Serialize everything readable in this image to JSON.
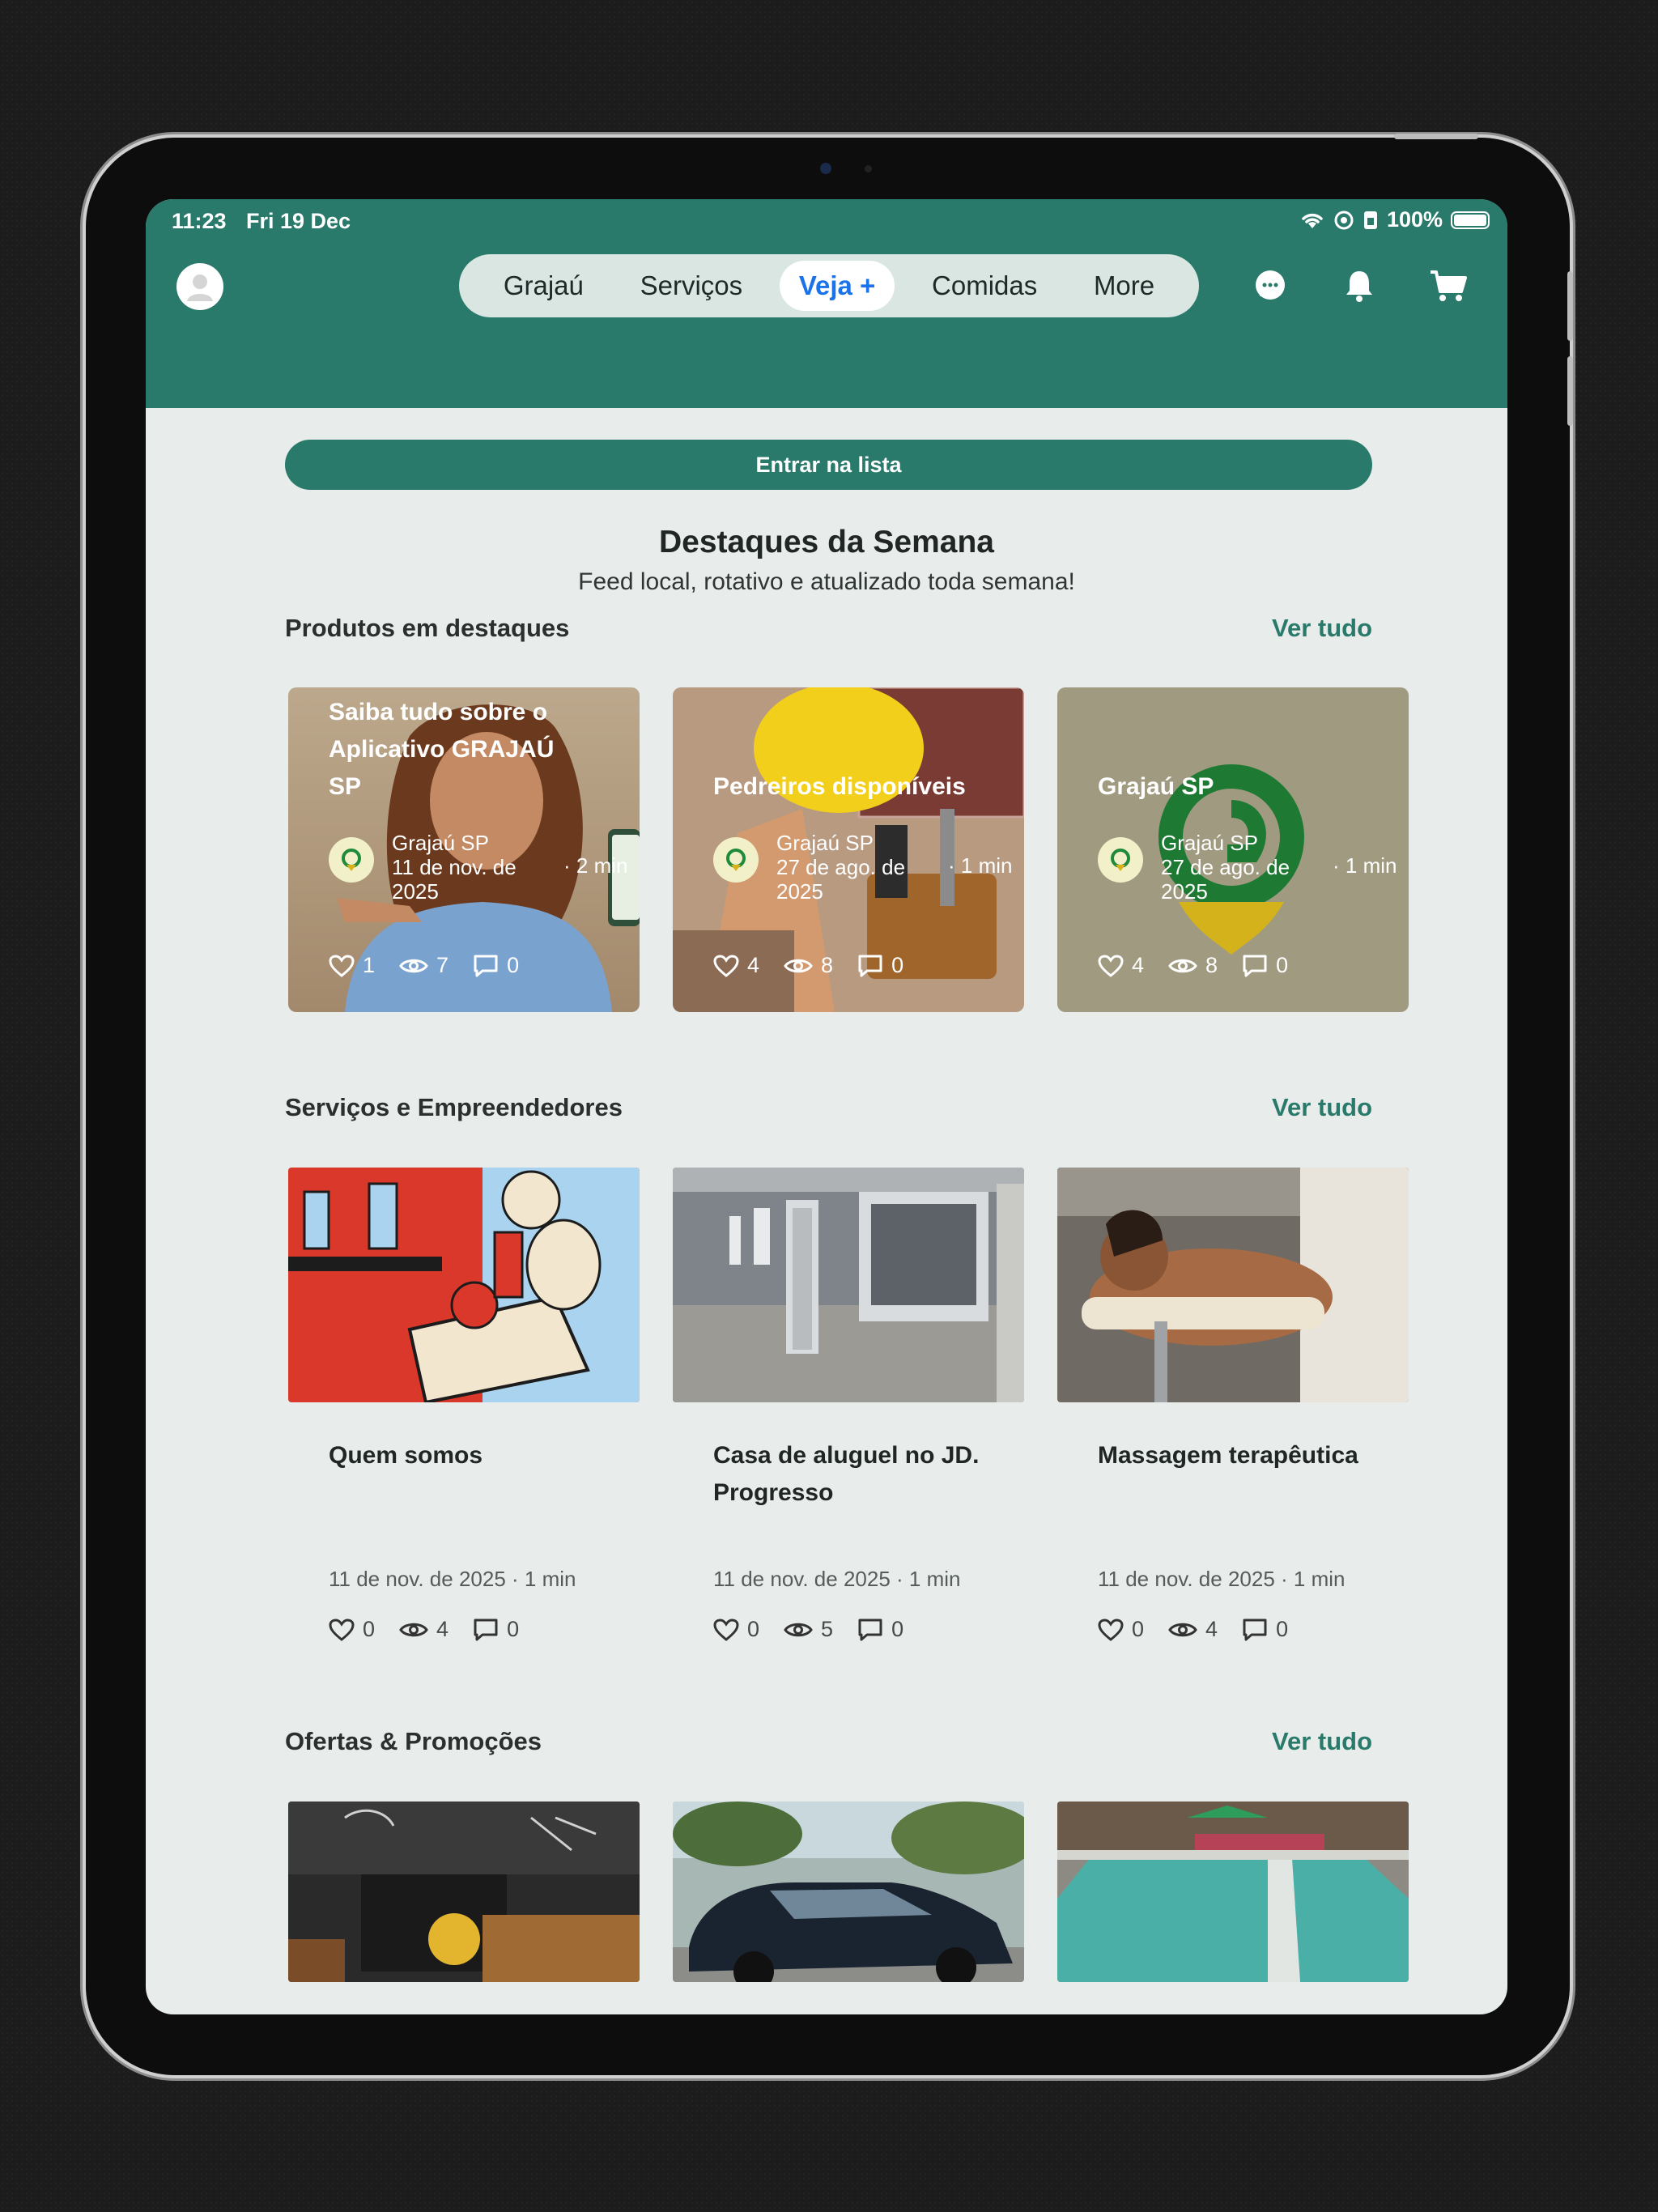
{
  "status_bar": {
    "time": "11:23",
    "date": "Fri 19 Dec",
    "battery": "100%"
  },
  "header": {
    "avatar_icon": "user-avatar-icon",
    "tabs": [
      {
        "label": "Grajaú",
        "active": false
      },
      {
        "label": "Serviços",
        "active": false
      },
      {
        "label": "Veja +",
        "active": true
      },
      {
        "label": "Comidas",
        "active": false
      },
      {
        "label": "More",
        "active": false
      }
    ],
    "icons": [
      "chat-icon",
      "bell-icon",
      "cart-icon"
    ],
    "color": "#2a7a6b"
  },
  "cta": {
    "label": "Entrar na lista"
  },
  "section": {
    "title": "Destaques da Semana",
    "subtitle": "Feed local, rotativo e atualizado toda semana!"
  },
  "featured": {
    "title": "Produtos em destaques",
    "link": "Ver tudo",
    "cards": [
      {
        "title": "Saiba tudo sobre o Aplicativo GRAJAÚ SP",
        "author": "Grajaú SP",
        "date": "11 de nov. de 2025",
        "read_time": "· 2 min",
        "likes": "1",
        "views": "7",
        "comments": "0"
      },
      {
        "title": "Pedreiros disponíveis",
        "author": "Grajaú SP",
        "date": "27 de ago. de 2025",
        "read_time": "· 1 min",
        "likes": "4",
        "views": "8",
        "comments": "0"
      },
      {
        "title": "Grajaú SP",
        "author": "Grajaú SP",
        "date": "27 de ago. de 2025",
        "read_time": "· 1 min",
        "likes": "4",
        "views": "8",
        "comments": "0"
      }
    ]
  },
  "services": {
    "title": "Serviços e Empreendedores",
    "link": "Ver tudo",
    "cards": [
      {
        "title": "Quem somos",
        "meta": "11 de nov. de 2025 · 1 min",
        "likes": "0",
        "views": "4",
        "comments": "0"
      },
      {
        "title": "Casa de aluguel no JD. Progresso",
        "meta": "11 de nov. de 2025 · 1 min",
        "likes": "0",
        "views": "5",
        "comments": "0"
      },
      {
        "title": "Massagem terapêutica",
        "meta": "11 de nov. de 2025 · 1 min",
        "likes": "0",
        "views": "4",
        "comments": "0"
      }
    ]
  },
  "offers": {
    "title": "Ofertas & Promoções",
    "link": "Ver tudo"
  }
}
